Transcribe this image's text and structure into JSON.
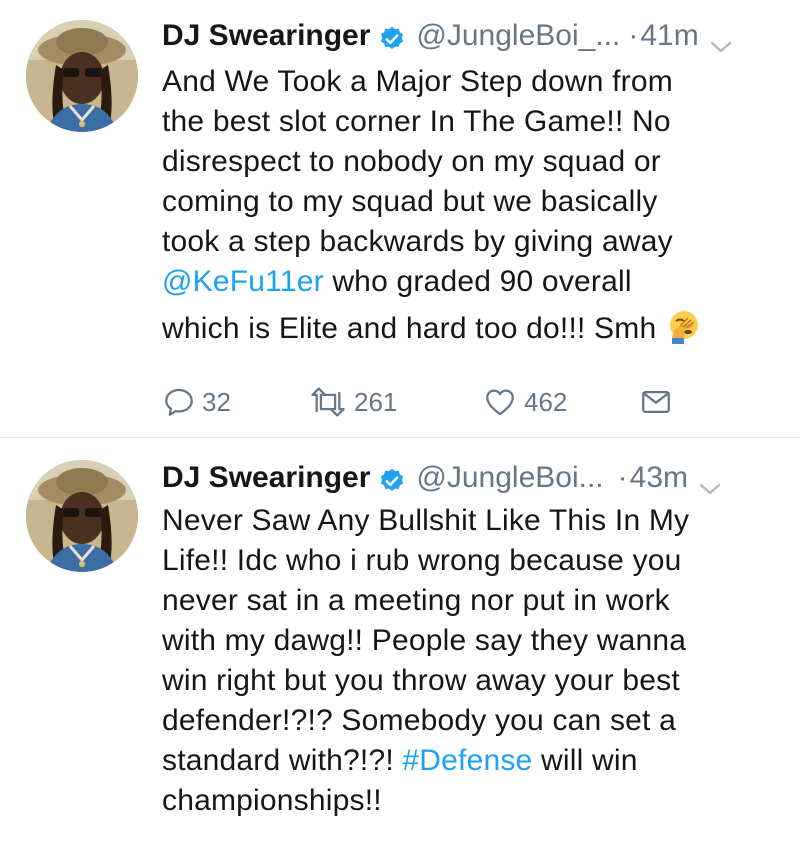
{
  "tweets": [
    {
      "name": "DJ Swearinger",
      "handle": "@JungleBoi_...",
      "dot": "·",
      "time": "41m",
      "lines": [
        [
          "And We Took a Major Step down from"
        ],
        [
          "the best slot corner In The Game!! No"
        ],
        [
          "disrespect to nobody on my squad or"
        ],
        [
          "coming to my squad but we basically"
        ],
        [
          "took a step backwards by giving away"
        ],
        [
          "@KeFu11er",
          " who graded 90 overall"
        ],
        [
          "which is Elite and hard too do!!! Smh"
        ]
      ],
      "emoji": "face-palm-emoji",
      "reply_count": "32",
      "retweet_count": "261",
      "like_count": "462"
    },
    {
      "name": "DJ Swearinger",
      "handle": "@JungleBoi...",
      "dot": "·",
      "time": "43m",
      "lines": [
        [
          "Never Saw Any Bullshit Like This In My"
        ],
        [
          "Life!! Idc who i rub wrong because you"
        ],
        [
          "never sat in a meeting nor put in work"
        ],
        [
          "with my dawg!! People say they wanna"
        ],
        [
          "win right but you throw away your best"
        ],
        [
          "defender!?!? Somebody you can set a"
        ],
        [
          "standard with?!?! ",
          "#Defense",
          " will win"
        ],
        [
          "championships!!"
        ]
      ]
    }
  ],
  "colors": {
    "link": "#1da1f2",
    "secondary_text": "#657786",
    "divider": "#e1e8ed",
    "verified_badge": "#1da1f2"
  }
}
